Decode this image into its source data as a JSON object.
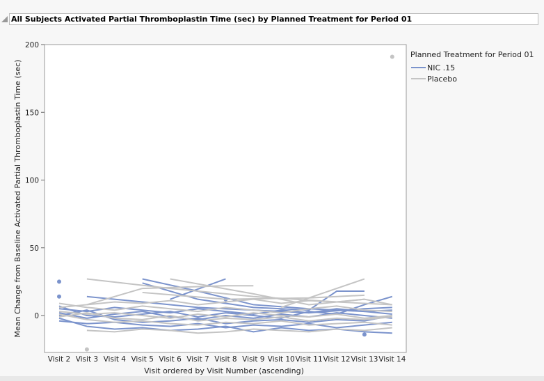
{
  "header": {
    "title": "All Subjects Activated Partial Thromboplastin Time (sec) by Planned Treatment for Period 01"
  },
  "chart_data": {
    "type": "line",
    "title": "All Subjects Activated Partial Thromboplastin Time (sec) by Planned Treatment for Period 01",
    "xlabel": "Visit ordered by Visit Number (ascending)",
    "ylabel": "Mean Change from Baseline Activated Partial Thromboplastin Time (sec)",
    "categories": [
      "Visit 2",
      "Visit 3",
      "Visit 4",
      "Visit 5",
      "Visit 6",
      "Visit 7",
      "Visit 8",
      "Visit 9",
      "Visit 10",
      "Visit 11",
      "Visit 12",
      "Visit 13",
      "Visit 14"
    ],
    "ylim": [
      -26,
      200
    ],
    "yticks": [
      0,
      50,
      100,
      150,
      200
    ],
    "legend": {
      "title": "Planned Treatment for Period 01",
      "position": "right",
      "entries": [
        {
          "name": "NIC .15",
          "color": "#7b93cc"
        },
        {
          "name": "Placebo",
          "color": "#c4c4c4"
        }
      ]
    },
    "series": [
      {
        "group": "NIC .15",
        "points": [
          [
            0,
            25
          ]
        ]
      },
      {
        "group": "NIC .15",
        "points": [
          [
            0,
            14
          ]
        ]
      },
      {
        "group": "NIC .15",
        "points": [
          [
            6,
            12
          ]
        ]
      },
      {
        "group": "NIC .15",
        "points": [
          [
            11,
            -14
          ]
        ]
      },
      {
        "group": "NIC .15",
        "points": [
          [
            0,
            2
          ],
          [
            1,
            -2
          ],
          [
            2,
            1
          ],
          [
            3,
            3
          ],
          [
            4,
            -1
          ],
          [
            5,
            -3
          ],
          [
            6,
            0
          ],
          [
            7,
            -2
          ],
          [
            8,
            1
          ],
          [
            9,
            -1
          ],
          [
            10,
            2
          ],
          [
            11,
            0
          ],
          [
            12,
            -2
          ]
        ]
      },
      {
        "group": "NIC .15",
        "points": [
          [
            0,
            -4
          ],
          [
            1,
            -6
          ],
          [
            2,
            -5
          ],
          [
            3,
            -7
          ],
          [
            4,
            -8
          ],
          [
            5,
            -6
          ],
          [
            6,
            -9
          ],
          [
            7,
            -7
          ],
          [
            8,
            -8
          ],
          [
            9,
            -6
          ],
          [
            10,
            -9
          ],
          [
            11,
            -7
          ],
          [
            12,
            -5
          ]
        ]
      },
      {
        "group": "NIC .15",
        "points": [
          [
            0,
            5
          ],
          [
            1,
            3
          ],
          [
            2,
            6
          ],
          [
            3,
            4
          ],
          [
            4,
            2
          ],
          [
            5,
            5
          ],
          [
            6,
            3
          ],
          [
            7,
            1
          ],
          [
            8,
            4
          ],
          [
            9,
            2
          ],
          [
            10,
            5
          ],
          [
            11,
            3
          ],
          [
            12,
            4
          ]
        ]
      },
      {
        "group": "NIC .15",
        "points": [
          [
            1,
            14
          ],
          [
            3,
            10
          ],
          [
            5,
            6
          ],
          [
            7,
            4
          ],
          [
            9,
            2
          ],
          [
            11,
            5
          ],
          [
            12,
            6
          ]
        ]
      },
      {
        "group": "NIC .15",
        "points": [
          [
            3,
            27
          ],
          [
            5,
            18
          ],
          [
            7,
            8
          ],
          [
            9,
            5
          ],
          [
            11,
            3
          ],
          [
            12,
            1
          ]
        ]
      },
      {
        "group": "NIC .15",
        "points": [
          [
            3,
            24
          ],
          [
            5,
            12
          ],
          [
            7,
            6
          ],
          [
            9,
            4
          ],
          [
            10,
            18
          ],
          [
            11,
            18
          ]
        ]
      },
      {
        "group": "NIC .15",
        "points": [
          [
            4,
            12
          ],
          [
            6,
            27
          ]
        ]
      },
      {
        "group": "NIC .15",
        "points": [
          [
            0,
            -2
          ],
          [
            1,
            -8
          ],
          [
            2,
            -10
          ],
          [
            3,
            -9
          ],
          [
            4,
            -11
          ],
          [
            5,
            -10
          ],
          [
            6,
            -8
          ],
          [
            7,
            -12
          ],
          [
            8,
            -9
          ],
          [
            9,
            -11
          ],
          [
            10,
            -10
          ],
          [
            11,
            -12
          ],
          [
            12,
            -13
          ]
        ]
      },
      {
        "group": "NIC .15",
        "points": [
          [
            0,
            0
          ],
          [
            1,
            4
          ],
          [
            2,
            -3
          ],
          [
            3,
            -5
          ],
          [
            4,
            -4
          ],
          [
            5,
            -2
          ],
          [
            6,
            -6
          ],
          [
            7,
            -4
          ],
          [
            8,
            -3
          ],
          [
            9,
            -5
          ],
          [
            10,
            -3
          ],
          [
            11,
            -4
          ],
          [
            12,
            0
          ]
        ]
      },
      {
        "group": "NIC .15",
        "points": [
          [
            0,
            7
          ],
          [
            1,
            0
          ],
          [
            2,
            -1
          ],
          [
            3,
            1
          ],
          [
            4,
            3
          ],
          [
            5,
            -1
          ],
          [
            6,
            2
          ],
          [
            7,
            0
          ],
          [
            8,
            -2
          ],
          [
            9,
            3
          ],
          [
            10,
            1
          ],
          [
            11,
            8
          ],
          [
            12,
            14
          ]
        ]
      },
      {
        "group": "Placebo",
        "points": [
          [
            1,
            -25
          ]
        ]
      },
      {
        "group": "Placebo",
        "points": [
          [
            12,
            191
          ]
        ]
      },
      {
        "group": "Placebo",
        "points": [
          [
            0,
            9
          ],
          [
            1,
            6
          ],
          [
            2,
            4
          ],
          [
            3,
            7
          ],
          [
            4,
            5
          ],
          [
            5,
            3
          ],
          [
            6,
            6
          ],
          [
            7,
            4
          ],
          [
            8,
            2
          ],
          [
            9,
            5
          ],
          [
            10,
            7
          ],
          [
            11,
            4
          ],
          [
            12,
            3
          ]
        ]
      },
      {
        "group": "Placebo",
        "points": [
          [
            0,
            3
          ],
          [
            1,
            1
          ],
          [
            2,
            2
          ],
          [
            3,
            0
          ],
          [
            4,
            -2
          ],
          [
            5,
            1
          ],
          [
            6,
            -1
          ],
          [
            7,
            2
          ],
          [
            8,
            0
          ],
          [
            9,
            -1
          ],
          [
            10,
            1
          ],
          [
            11,
            -2
          ],
          [
            12,
            0
          ]
        ]
      },
      {
        "group": "Placebo",
        "points": [
          [
            1,
            27
          ],
          [
            4,
            20
          ],
          [
            7,
            14
          ],
          [
            10,
            10
          ],
          [
            12,
            8
          ]
        ]
      },
      {
        "group": "Placebo",
        "points": [
          [
            4,
            27
          ],
          [
            7,
            16
          ],
          [
            9,
            8
          ],
          [
            11,
            12
          ]
        ]
      },
      {
        "group": "Placebo",
        "points": [
          [
            1,
            8
          ],
          [
            3,
            20
          ],
          [
            6,
            22
          ],
          [
            7,
            22
          ]
        ]
      },
      {
        "group": "Placebo",
        "points": [
          [
            8,
            6
          ],
          [
            11,
            27
          ]
        ]
      },
      {
        "group": "Placebo",
        "points": [
          [
            1,
            -11
          ],
          [
            2,
            -12
          ],
          [
            3,
            -10
          ],
          [
            4,
            -11
          ],
          [
            5,
            -13
          ],
          [
            6,
            -12
          ],
          [
            7,
            -10
          ],
          [
            8,
            -11
          ],
          [
            9,
            -12
          ],
          [
            10,
            -10
          ],
          [
            11,
            -11
          ],
          [
            12,
            -9
          ]
        ]
      },
      {
        "group": "Placebo",
        "points": [
          [
            0,
            1
          ],
          [
            1,
            -3
          ],
          [
            2,
            -5
          ],
          [
            3,
            -4
          ],
          [
            4,
            -6
          ],
          [
            5,
            -7
          ],
          [
            6,
            -5
          ],
          [
            7,
            -6
          ],
          [
            8,
            -4
          ],
          [
            9,
            -7
          ],
          [
            10,
            -6
          ],
          [
            11,
            -5
          ],
          [
            12,
            -7
          ]
        ]
      },
      {
        "group": "Placebo",
        "points": [
          [
            0,
            6
          ],
          [
            1,
            8
          ],
          [
            2,
            10
          ],
          [
            3,
            9
          ],
          [
            4,
            11
          ],
          [
            5,
            8
          ],
          [
            6,
            10
          ],
          [
            7,
            12
          ],
          [
            8,
            9
          ],
          [
            9,
            11
          ],
          [
            10,
            10
          ],
          [
            11,
            12
          ],
          [
            12,
            8
          ]
        ]
      },
      {
        "group": "Placebo",
        "points": [
          [
            3,
            17
          ],
          [
            6,
            12
          ],
          [
            9,
            13
          ],
          [
            11,
            15
          ]
        ]
      },
      {
        "group": "Placebo",
        "points": [
          [
            0,
            -1
          ],
          [
            1,
            2
          ],
          [
            2,
            -2
          ],
          [
            3,
            -3
          ],
          [
            4,
            0
          ],
          [
            5,
            -4
          ],
          [
            6,
            -2
          ],
          [
            7,
            -3
          ],
          [
            8,
            -1
          ],
          [
            9,
            -4
          ],
          [
            10,
            -2
          ],
          [
            11,
            -3
          ],
          [
            12,
            -1
          ]
        ]
      }
    ]
  }
}
